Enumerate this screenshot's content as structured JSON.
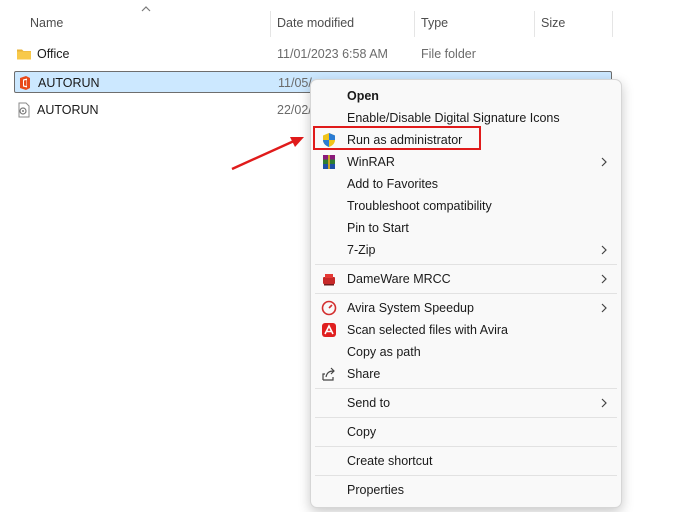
{
  "columns": {
    "name": "Name",
    "date": "Date modified",
    "type": "Type",
    "size": "Size"
  },
  "files": [
    {
      "name": "Office",
      "date": "11/01/2023 6:58 AM",
      "type": "File folder",
      "size": "",
      "icon": "folder-icon"
    },
    {
      "name": "AUTORUN",
      "date": "11/05/",
      "type": "",
      "size": "",
      "icon": "office-app-icon"
    },
    {
      "name": "AUTORUN",
      "date": "22/02/",
      "type": "",
      "size": "",
      "icon": "setup-info-icon"
    }
  ],
  "menu": {
    "items": {
      "open": "Open",
      "signature": "Enable/Disable Digital Signature Icons",
      "run_admin": "Run as administrator",
      "winrar": "WinRAR",
      "favorites": "Add to Favorites",
      "troubleshoot": "Troubleshoot compatibility",
      "pin_start": "Pin to Start",
      "seven_zip": "7-Zip",
      "dameware": "DameWare MRCC",
      "avira_speedup": "Avira System Speedup",
      "avira_scan": "Scan selected files with Avira",
      "copy_path": "Copy as path",
      "share": "Share",
      "send_to": "Send to",
      "copy": "Copy",
      "create_shortcut": "Create shortcut",
      "properties": "Properties"
    }
  },
  "colors": {
    "accent_red": "#e01b1b",
    "selection": "#cce8ff",
    "folder": "#f8c94a"
  }
}
